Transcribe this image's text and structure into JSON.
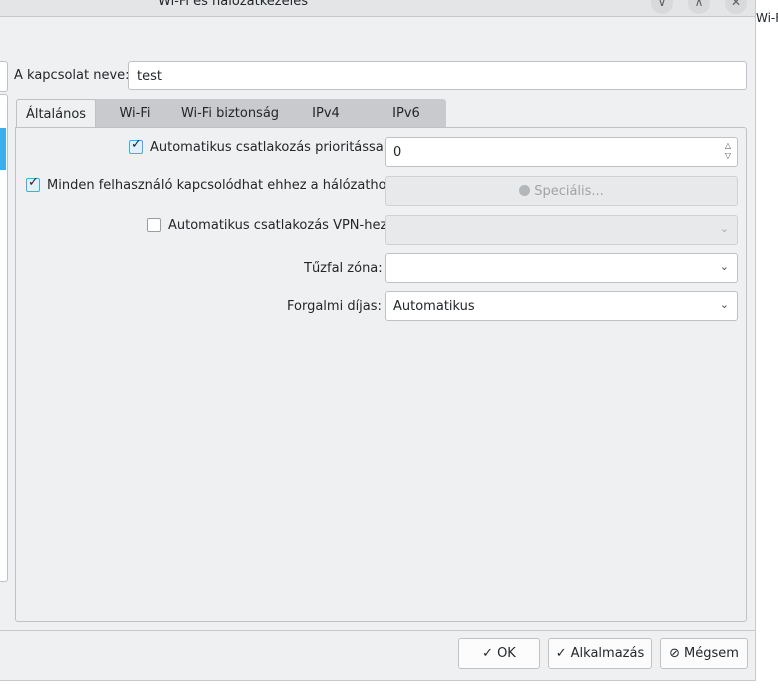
{
  "window": {
    "title": "Wi-Fi és hálózatkezelés",
    "offscreen_label": "Wi-F"
  },
  "connection": {
    "label": "A kapcsolat neve:",
    "value": "test"
  },
  "tabs": [
    {
      "label": "Általános",
      "active": true
    },
    {
      "label": "Wi-Fi",
      "active": false
    },
    {
      "label": "Wi-Fi biztonság",
      "active": false
    },
    {
      "label": "IPv4",
      "active": false
    },
    {
      "label": "IPv6",
      "active": false
    }
  ],
  "general": {
    "auto_connect_label": "Automatikus csatlakozás prioritással",
    "auto_connect_checked": true,
    "priority_value": "0",
    "all_users_label": "Minden felhasználó kapcsolódhat ehhez a hálózathoz",
    "all_users_checked": true,
    "special_button_label": "Speciális...",
    "vpn_auto_label": "Automatikus csatlakozás VPN-hez",
    "vpn_auto_checked": false,
    "vpn_value": "",
    "firewall_label": "Tűzfal zóna:",
    "firewall_value": "",
    "metered_label": "Forgalmi díjas:",
    "metered_value": "Automatikus"
  },
  "buttons": {
    "ok": "OK",
    "apply": "Alkalmazás",
    "cancel": "Mégsem"
  },
  "icons": {
    "ok": "check-icon",
    "apply": "check-icon",
    "cancel": "cancel-icon",
    "special": "people-icon",
    "window_minimize": "chevron-down-icon",
    "window_maximize": "chevron-up-icon",
    "window_close": "close-icon"
  },
  "colors": {
    "accent": "#3daee9",
    "background": "#eff0f1",
    "border": "#bfc2c5"
  }
}
